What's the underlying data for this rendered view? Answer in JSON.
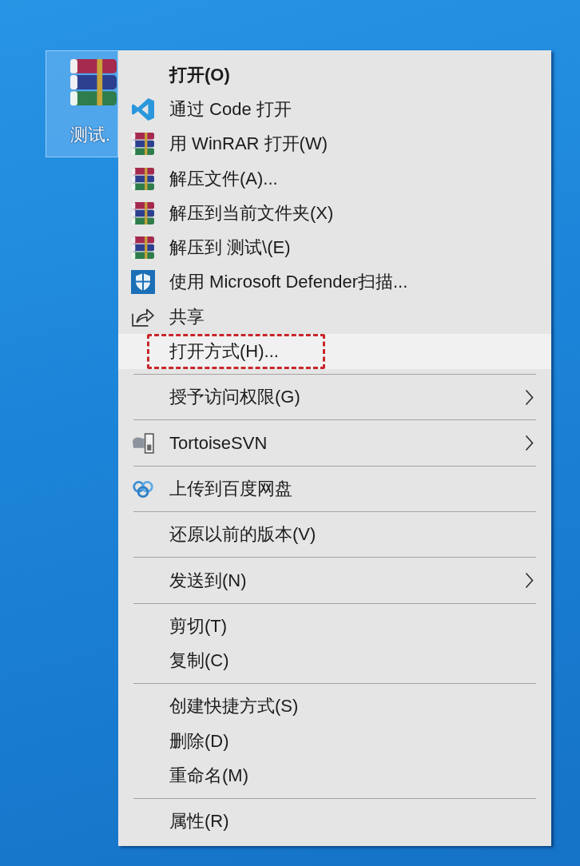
{
  "desktop": {
    "items": [
      {
        "label": "测试.",
        "selected": true
      }
    ]
  },
  "context_menu": {
    "sections": [
      {
        "items": [
          {
            "label": "打开(O)",
            "kind": "plain",
            "default": true,
            "selected": false,
            "marked": false,
            "submenu": false
          },
          {
            "label": "通过 Code 打开",
            "kind": "code",
            "default": false,
            "selected": false,
            "marked": false,
            "submenu": false
          },
          {
            "label": "用 WinRAR 打开(W)",
            "kind": "archive",
            "default": false,
            "selected": false,
            "marked": false,
            "submenu": false
          },
          {
            "label": "解压文件(A)...",
            "kind": "archive",
            "default": false,
            "selected": false,
            "marked": false,
            "submenu": false
          },
          {
            "label": "解压到当前文件夹(X)",
            "kind": "archive",
            "default": false,
            "selected": false,
            "marked": false,
            "submenu": false
          },
          {
            "label": "解压到 测试\\(E)",
            "kind": "archive",
            "default": false,
            "selected": false,
            "marked": false,
            "submenu": false
          },
          {
            "label": "使用 Microsoft Defender扫描...",
            "kind": "shield",
            "default": false,
            "selected": false,
            "marked": false,
            "submenu": false
          },
          {
            "label": "共享",
            "kind": "share",
            "default": false,
            "selected": false,
            "marked": false,
            "submenu": false
          },
          {
            "label": "打开方式(H)...",
            "kind": "plain",
            "default": false,
            "selected": true,
            "marked": true,
            "submenu": false
          }
        ]
      },
      {
        "items": [
          {
            "label": "授予访问权限(G)",
            "kind": "plain",
            "default": false,
            "selected": false,
            "marked": false,
            "submenu": true
          }
        ]
      },
      {
        "items": [
          {
            "label": "TortoiseSVN",
            "kind": "svn",
            "default": false,
            "selected": false,
            "marked": false,
            "submenu": true
          }
        ]
      },
      {
        "items": [
          {
            "label": "上传到百度网盘",
            "kind": "cloud",
            "default": false,
            "selected": false,
            "marked": false,
            "submenu": false
          }
        ]
      },
      {
        "items": [
          {
            "label": "还原以前的版本(V)",
            "kind": "plain",
            "default": false,
            "selected": false,
            "marked": false,
            "submenu": false
          }
        ]
      },
      {
        "items": [
          {
            "label": "发送到(N)",
            "kind": "plain",
            "default": false,
            "selected": false,
            "marked": false,
            "submenu": true
          }
        ]
      },
      {
        "items": [
          {
            "label": "剪切(T)",
            "kind": "plain",
            "default": false,
            "selected": false,
            "marked": false,
            "submenu": false
          },
          {
            "label": "复制(C)",
            "kind": "plain",
            "default": false,
            "selected": false,
            "marked": false,
            "submenu": false
          }
        ]
      },
      {
        "items": [
          {
            "label": "创建快捷方式(S)",
            "kind": "plain",
            "default": false,
            "selected": false,
            "marked": false,
            "submenu": false
          },
          {
            "label": "删除(D)",
            "kind": "plain",
            "default": false,
            "selected": false,
            "marked": false,
            "submenu": false
          },
          {
            "label": "重命名(M)",
            "kind": "plain",
            "default": false,
            "selected": false,
            "marked": false,
            "submenu": false
          }
        ]
      },
      {
        "items": [
          {
            "label": "属性(R)",
            "kind": "plain",
            "default": false,
            "selected": false,
            "marked": false,
            "submenu": false
          }
        ]
      }
    ]
  }
}
